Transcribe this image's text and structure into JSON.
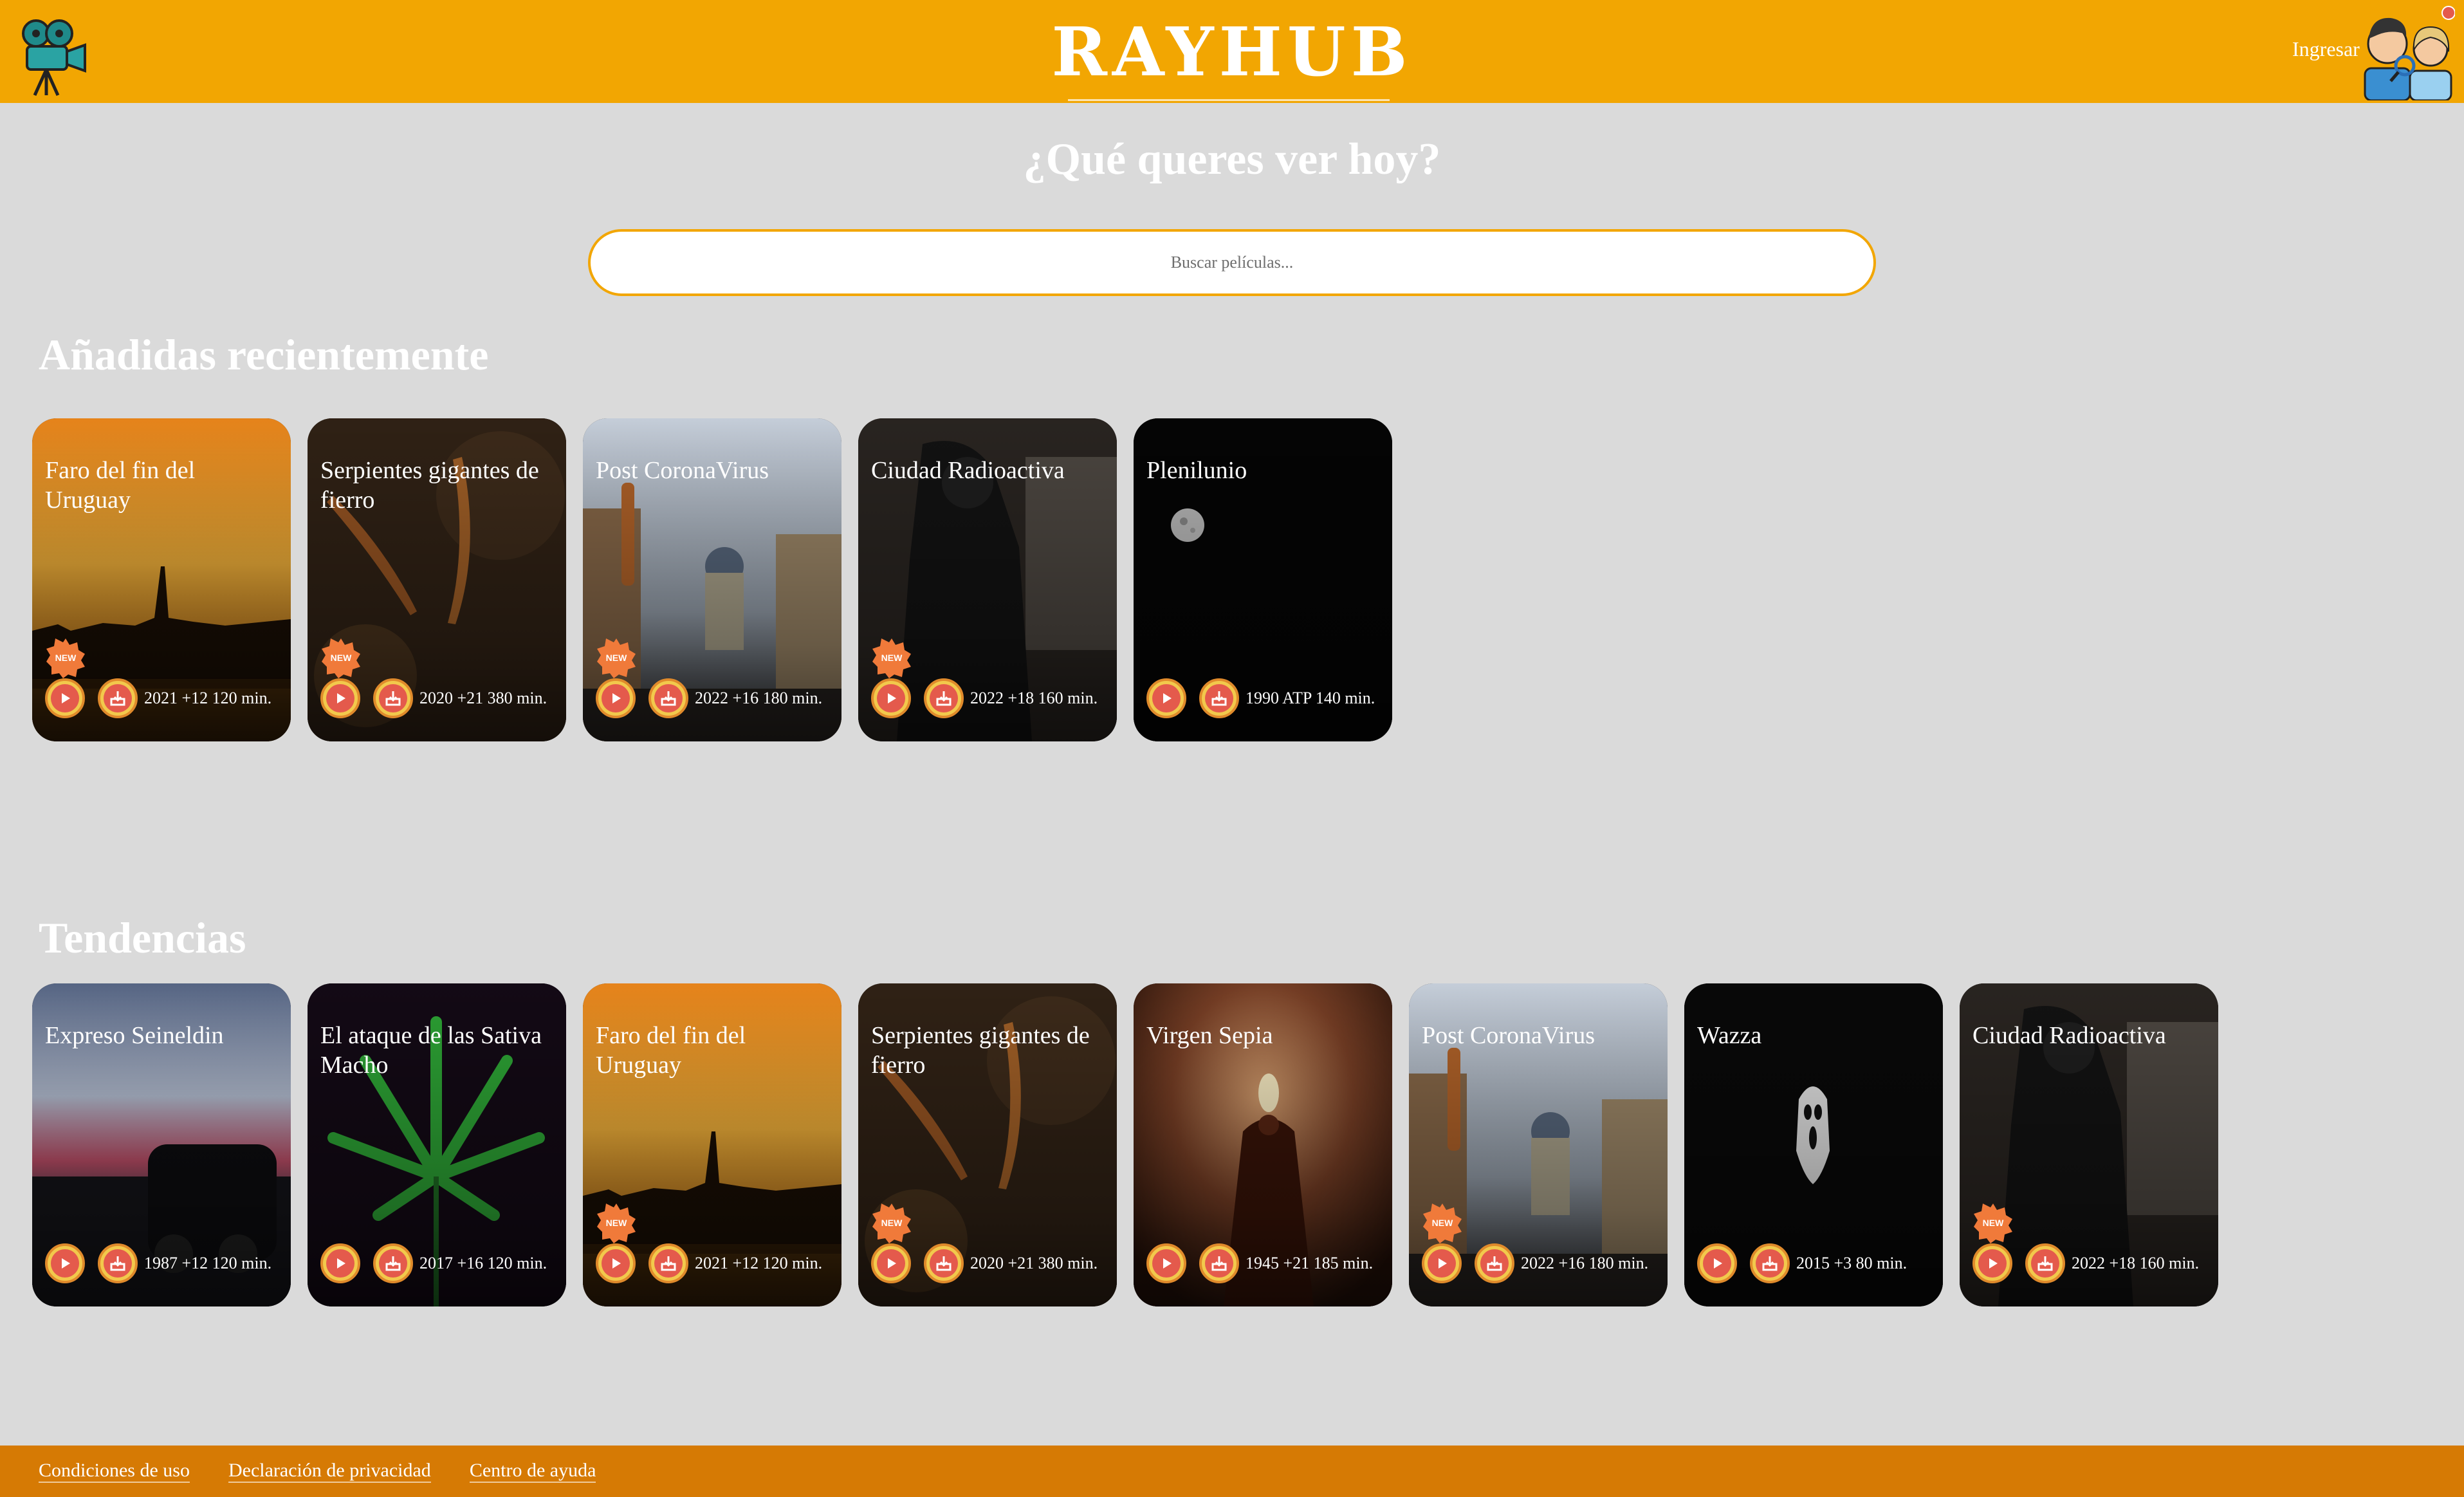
{
  "header": {
    "logo_text": "RAYHUB",
    "login_label": "Ingresar"
  },
  "hero": {
    "title": "¿Qué queres ver hoy?",
    "search_placeholder": "Buscar películas..."
  },
  "recent": {
    "title": "Añadidas recientemente",
    "items": [
      {
        "title": "Faro del fin del Uruguay",
        "meta": "2021 +12 120 min.",
        "badge": "NEW",
        "scene": "sunset-lighthouse"
      },
      {
        "title": "Serpientes gigantes de fierro",
        "meta": "2020 +21 380 min.",
        "badge": "NEW",
        "scene": "rusty-nails"
      },
      {
        "title": "Post CoronaVirus",
        "meta": "2022 +16 180 min.",
        "badge": "NEW",
        "scene": "street"
      },
      {
        "title": "Ciudad Radioactiva",
        "meta": "2022 +18 160 min.",
        "badge": "NEW",
        "scene": "gasmask"
      },
      {
        "title": "Plenilunio",
        "meta": "1990 ATP 140 min.",
        "badge": "",
        "scene": "moon"
      }
    ]
  },
  "trending": {
    "title": "Tendencias",
    "items": [
      {
        "title": "Expreso Seineldin",
        "meta": "1987 +12 120 min.",
        "badge": "",
        "scene": "train"
      },
      {
        "title": "El ataque de las Sativa Macho",
        "meta": "2017 +16 120 min.",
        "badge": "",
        "scene": "leaf"
      },
      {
        "title": "Faro del fin del Uruguay",
        "meta": "2021 +12 120 min.",
        "badge": "NEW",
        "scene": "sunset-lighthouse"
      },
      {
        "title": "Serpientes gigantes de fierro",
        "meta": "2020 +21 380 min.",
        "badge": "NEW",
        "scene": "rusty-nails"
      },
      {
        "title": "Virgen Sepia",
        "meta": "1945 +21 185 min.",
        "badge": "",
        "scene": "virgin"
      },
      {
        "title": "Post CoronaVirus",
        "meta": "2022 +16 180 min.",
        "badge": "NEW",
        "scene": "street"
      },
      {
        "title": "Wazza",
        "meta": "2015 +3 80 min.",
        "badge": "",
        "scene": "scream"
      },
      {
        "title": "Ciudad Radioactiva",
        "meta": "2022 +18 160 min.",
        "badge": "NEW",
        "scene": "gasmask"
      }
    ]
  },
  "footer": {
    "links": [
      "Condiciones de uso",
      "Declaración de privacidad",
      "Centro de ayuda"
    ]
  },
  "colors": {
    "header": "#f2a602",
    "footer": "#d67a04",
    "background": "#dadada"
  }
}
